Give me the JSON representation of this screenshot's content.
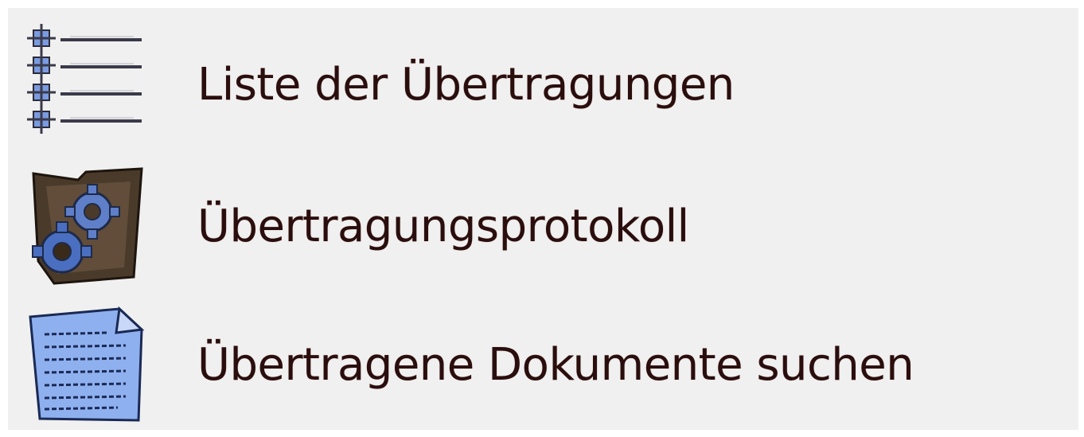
{
  "menu": {
    "items": [
      {
        "label": "Liste der Übertragungen",
        "icon": "checklist-icon"
      },
      {
        "label": "Übertragungsprotokoll",
        "icon": "gear-folder-icon"
      },
      {
        "label": "Übertragene Dokumente suchen",
        "icon": "document-search-icon"
      }
    ]
  },
  "colors": {
    "background": "#f0f0f0",
    "text": "#2a0e0e",
    "icon_blue": "#4a6fc0",
    "icon_brown": "#4a3a2a"
  }
}
